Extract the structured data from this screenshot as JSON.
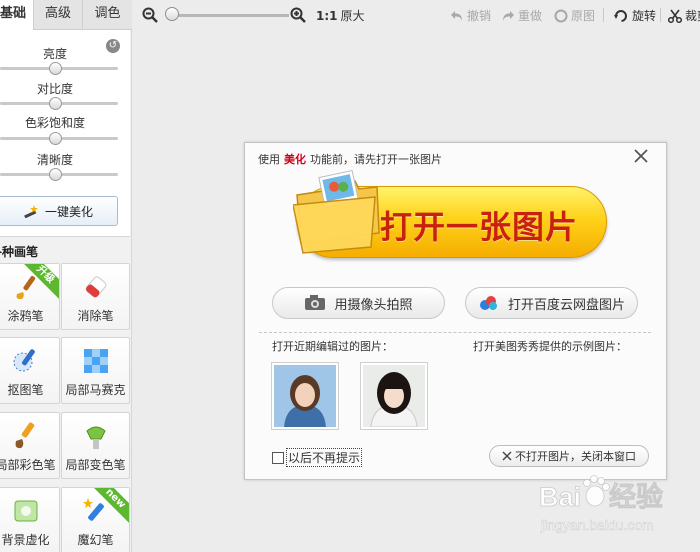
{
  "tabs": [
    {
      "label": "基础",
      "active": true
    },
    {
      "label": "高级",
      "active": false
    },
    {
      "label": "调色",
      "active": false
    }
  ],
  "adjust": {
    "reset_icon": "reset-icon",
    "sliders": [
      {
        "label": "亮度",
        "value": 0.47
      },
      {
        "label": "对比度",
        "value": 0.47
      },
      {
        "label": "色彩饱和度",
        "value": 0.47
      },
      {
        "label": "清晰度",
        "value": 0.47
      }
    ],
    "one_key_label": "一键美化"
  },
  "brushes": {
    "title": "各种画笔",
    "tools": [
      {
        "label": "涂鸦笔",
        "icon": "paintbrush-icon",
        "badge": "升级"
      },
      {
        "label": "消除笔",
        "icon": "eraser-icon",
        "badge": ""
      },
      {
        "label": "抠图笔",
        "icon": "cutout-pen-icon",
        "badge": ""
      },
      {
        "label": "局部马赛克",
        "icon": "mosaic-icon",
        "badge": ""
      },
      {
        "label": "局部彩色笔",
        "icon": "color-brush-icon",
        "badge": ""
      },
      {
        "label": "局部变色笔",
        "icon": "color-change-icon",
        "badge": ""
      },
      {
        "label": "背景虚化",
        "icon": "blur-icon",
        "badge": ""
      },
      {
        "label": "魔幻笔",
        "icon": "magic-pen-icon",
        "badge": "new"
      }
    ]
  },
  "toolbar": {
    "zoom_out_icon": "zoom-out-icon",
    "zoom_in_icon": "zoom-in-icon",
    "zoom_value": 0.1,
    "ratio_label": "1:1",
    "original_size_label": "原大",
    "undo_label": "撤销",
    "redo_label": "重做",
    "original_label": "原图",
    "rotate_label": "旋转",
    "crop_label": "裁剪"
  },
  "dialog": {
    "title_prefix": "使用",
    "title_highlight": "美化",
    "title_suffix": "功能前，请先打开一张图片",
    "open_button_label": "打开一张图片",
    "camera_button_label": "用摄像头拍照",
    "cloud_button_label": "打开百度云网盘图片",
    "recent_label": "打开近期编辑过的图片：",
    "samples_label": "打开美图秀秀提供的示例图片：",
    "no_show_label": "以后不再提示",
    "close_window_label": "不打开图片，关闭本窗口"
  },
  "watermark": {
    "brand": "Baidu经验",
    "url": "jingyan.baidu.com"
  },
  "colors": {
    "accent_red": "#d0021b",
    "button_yellow": "#ffd21a",
    "badge_green": "#5cb82f"
  }
}
